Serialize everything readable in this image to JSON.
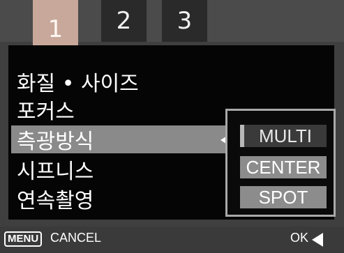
{
  "tabs": [
    {
      "label": "1",
      "active": true
    },
    {
      "label": "2",
      "active": false
    },
    {
      "label": "3",
      "active": false
    }
  ],
  "menu": {
    "items": [
      {
        "label": "화질 • 사이즈"
      },
      {
        "label": "포커스"
      },
      {
        "label": "측광방식",
        "selected": true
      },
      {
        "label": "시프니스"
      },
      {
        "label": "연속촬영"
      }
    ]
  },
  "submenu": {
    "options": [
      {
        "label": "MULTI",
        "current": true
      },
      {
        "label": "CENTER"
      },
      {
        "label": "SPOT"
      }
    ]
  },
  "footer": {
    "menu_key": "MENU",
    "cancel_label": "CANCEL",
    "ok_label": "OK"
  },
  "colors": {
    "active_tab": "#c8a89a",
    "selected_row": "#8a8a8a",
    "submenu_border": "#a9a9a9"
  }
}
